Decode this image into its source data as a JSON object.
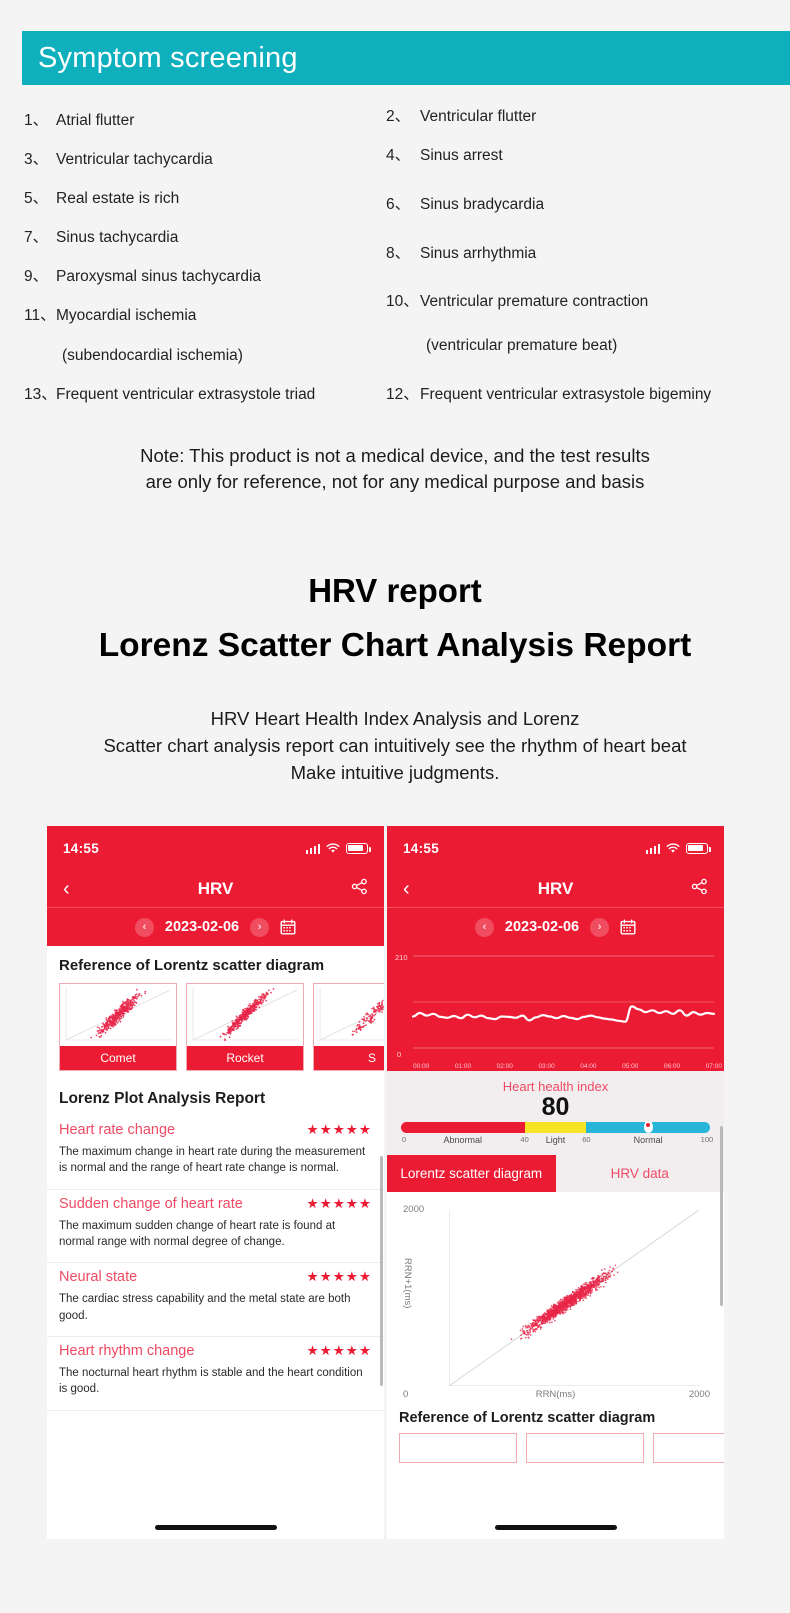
{
  "banner": {
    "title": "Symptom screening"
  },
  "symptoms": {
    "left": [
      {
        "num": "1、",
        "text": "Atrial flutter"
      },
      {
        "num": "3、",
        "text": "Ventricular tachycardia"
      },
      {
        "num": "5、",
        "text": "Real estate is rich"
      },
      {
        "num": "7、",
        "text": "Sinus tachycardia"
      },
      {
        "num": "9、",
        "text": "Paroxysmal sinus tachycardia"
      },
      {
        "num": "11、",
        "text": "Myocardial ischemia"
      },
      {
        "num": "",
        "text": "(subendocardial ischemia)"
      },
      {
        "num": "13、",
        "text": "Frequent ventricular extrasystole triad"
      }
    ],
    "right": [
      {
        "num": "2、",
        "text": "Ventricular flutter"
      },
      {
        "num": "4、",
        "text": "Sinus arrest"
      },
      {
        "num": "6、",
        "text": "Sinus bradycardia"
      },
      {
        "num": "8、",
        "text": "Sinus arrhythmia"
      },
      {
        "num": "10、",
        "text": "Ventricular premature contraction"
      },
      {
        "num": "",
        "text": "(ventricular premature beat)"
      },
      {
        "num": "12、",
        "text": "Frequent ventricular extrasystole bigeminy"
      }
    ]
  },
  "note": {
    "line1": "Note: This product is not a medical device, and the test results",
    "line2": "are only for reference, not for any medical purpose and basis"
  },
  "headings": {
    "hrv_report": "HRV report",
    "lorenz_report": "Lorenz Scatter Chart Analysis Report"
  },
  "intro": {
    "line1": "HRV Heart Health Index Analysis and Lorenz",
    "line2": "Scatter chart analysis report can intuitively see the rhythm of heart beat",
    "line3": "Make intuitive judgments."
  },
  "phone_left": {
    "status": {
      "time": "14:55",
      "signal_icon": "signal-bars-icon",
      "wifi_icon": "wifi-icon",
      "battery_icon": "battery-icon"
    },
    "nav": {
      "back_icon": "chevron-left-icon",
      "title": "HRV",
      "share_icon": "share-icon"
    },
    "date": {
      "prev_icon": "chevron-left-circle-icon",
      "value": "2023-02-06",
      "next_icon": "chevron-right-circle-icon",
      "calendar_icon": "calendar-icon"
    },
    "reference_title": "Reference of Lorentz scatter diagram",
    "thumbnails": [
      {
        "label": "Comet"
      },
      {
        "label": "Rocket"
      },
      {
        "label": "S"
      }
    ],
    "report_title": "Lorenz Plot Analysis Report",
    "report_items": [
      {
        "name": "Heart rate change",
        "stars": "★★★★★",
        "desc": "The maximum change in heart rate during the measurement is normal and the range of heart rate change is normal."
      },
      {
        "name": "Sudden change of heart rate",
        "stars": "★★★★★",
        "desc": "The maximum sudden change of heart rate is found at normal range with normal degree of change."
      },
      {
        "name": "Neural state",
        "stars": "★★★★★",
        "desc": "The cardiac stress capability and the metal state are both good."
      },
      {
        "name": "Heart rhythm change",
        "stars": "★★★★★",
        "desc": "The nocturnal heart rhythm is stable and the heart condition is good."
      }
    ]
  },
  "phone_right": {
    "status": {
      "time": "14:55",
      "signal_icon": "signal-bars-icon",
      "wifi_icon": "wifi-icon",
      "battery_icon": "battery-icon"
    },
    "nav": {
      "back_icon": "chevron-left-icon",
      "title": "HRV",
      "share_icon": "share-icon"
    },
    "date": {
      "prev_icon": "chevron-left-circle-icon",
      "value": "2023-02-06",
      "next_icon": "chevron-right-circle-icon",
      "calendar_icon": "calendar-icon"
    },
    "health_index": {
      "label": "Heart health index",
      "value": "80"
    },
    "gauge": {
      "zones": [
        {
          "label": "Abnormal",
          "color": "#ec1b34",
          "from": 0,
          "to": 40
        },
        {
          "label": "Light",
          "color": "#f6e325",
          "from": 40,
          "to": 60
        },
        {
          "label": "Normal",
          "color": "#27b5d8",
          "from": 60,
          "to": 100
        }
      ],
      "ticks": [
        "0",
        "40",
        "60",
        "100"
      ],
      "marker_value": 80
    },
    "tabs": [
      {
        "label": "Lorentz scatter diagram",
        "active": true
      },
      {
        "label": "HRV data",
        "active": false
      }
    ],
    "reference_title": "Reference of Lorentz scatter diagram"
  },
  "colors": {
    "banner_teal": "#0eb0bd",
    "app_red": "#ec1b34",
    "accent_pink": "#ef4a63",
    "page_bg": "#f4f4f4"
  },
  "chart_data": [
    {
      "type": "line",
      "title": "Heart rate over night",
      "xlabel": "",
      "ylabel": "",
      "ylim": [
        0,
        210
      ],
      "ytick_labels": [
        "0",
        "210"
      ],
      "x": [
        "00:00",
        "01:00",
        "02:00",
        "03:00",
        "04:00",
        "05:00",
        "06:00",
        "07:00"
      ],
      "values": [
        72,
        80,
        74,
        78,
        71,
        69,
        73,
        68,
        76,
        70,
        74,
        68,
        66,
        72,
        71,
        69,
        74,
        63,
        70,
        75,
        72,
        68,
        73,
        69,
        66,
        71,
        74,
        70,
        67,
        65,
        62,
        60,
        95,
        88,
        82,
        86,
        80,
        84,
        78,
        86,
        74,
        82,
        76,
        80,
        78
      ],
      "grid": true,
      "legend": "none",
      "line_color": "#ffffff",
      "bg_color": "#ec1b34"
    },
    {
      "type": "scatter",
      "title": "Lorentz scatter diagram",
      "xlabel": "RRN(ms)",
      "ylabel": "RRN+1(ms)",
      "xlim": [
        0,
        2000
      ],
      "ylim": [
        0,
        2000
      ],
      "xtick_labels": [
        "0",
        "2000"
      ],
      "ytick_labels": [
        "0",
        "2000"
      ],
      "point_color": "#e8274a",
      "identity_line": true,
      "cluster_center": [
        950,
        950
      ],
      "cluster_spread_major": 420,
      "cluster_spread_minor": 55,
      "n_points": 1400
    }
  ]
}
